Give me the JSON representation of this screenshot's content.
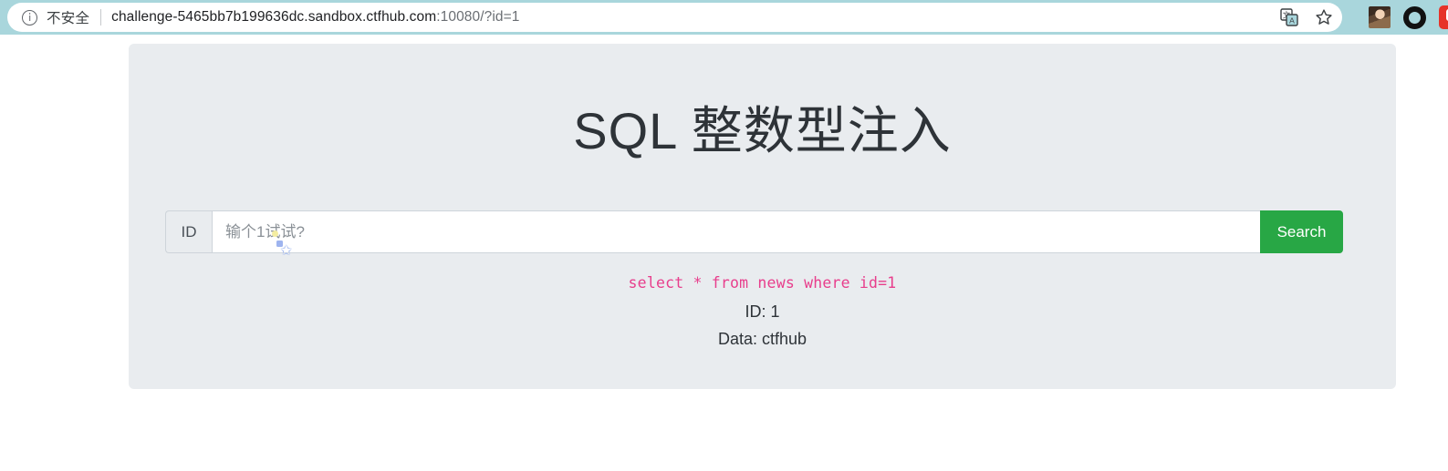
{
  "browser": {
    "security_label": "不安全",
    "security_icon": "info-circle-icon",
    "url_main": "challenge-5465bb7b199636dc.sandbox.ctfhub.com",
    "url_dim": ":10080/?id=1",
    "full_url": "challenge-5465bb7b199636dc.sandbox.ctfhub.com:10080/?id=1",
    "actions": {
      "translate": "translate-icon",
      "bookmark": "star-icon",
      "profile": "avatar-icon",
      "extension_circle": "black-circle-icon",
      "extension_red": "red-extension-icon"
    }
  },
  "page": {
    "title": "SQL 整数型注入",
    "form": {
      "prefix_label": "ID",
      "input_value": "",
      "input_placeholder": "输个1试试?",
      "submit_label": "Search"
    },
    "output": {
      "sql_query": "select * from news where id=1",
      "id_line": "ID: 1",
      "data_line": "Data: ctfhub"
    },
    "decoration": {
      "sparkle_glyph": "✩"
    }
  },
  "colors": {
    "chrome_bg": "#a9d6dc",
    "card_bg": "#e9ecef",
    "button_green": "#28a745",
    "sql_pink": "#e83e8c",
    "heading": "#2e3338"
  }
}
